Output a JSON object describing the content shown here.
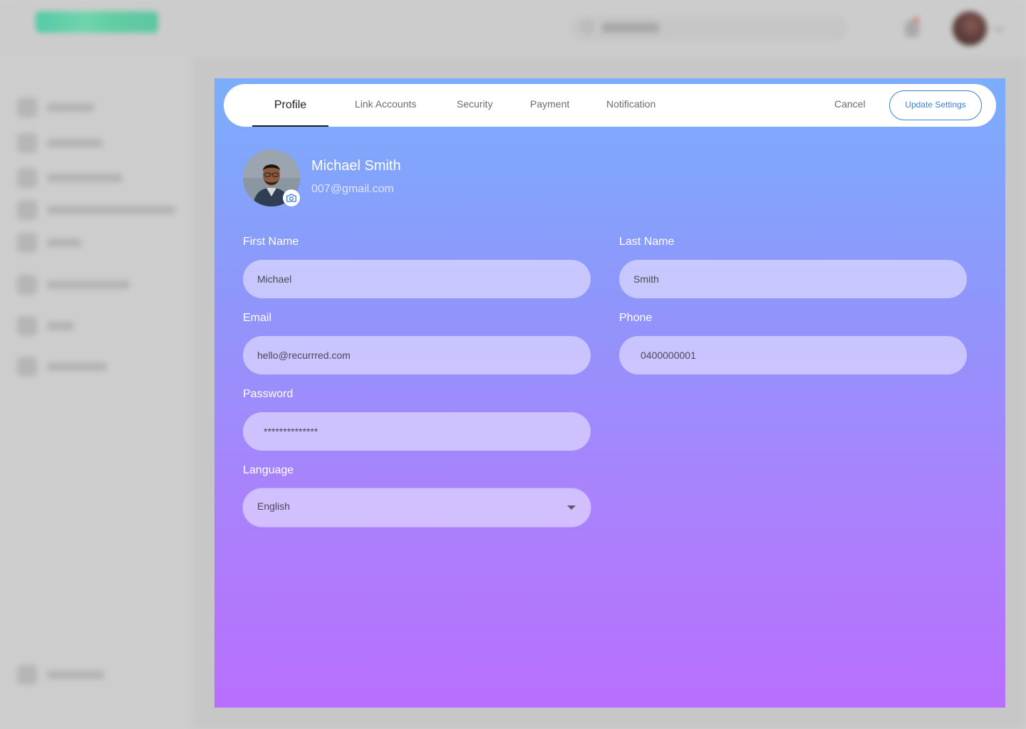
{
  "modal": {
    "tabs": [
      {
        "label": "Profile",
        "active": true
      },
      {
        "label": "Link Accounts",
        "active": false
      },
      {
        "label": "Security",
        "active": false
      },
      {
        "label": "Payment",
        "active": false
      },
      {
        "label": "Notification",
        "active": false
      }
    ],
    "cancel_label": "Cancel",
    "update_label": "Update Settings"
  },
  "profile": {
    "name": "Michael Smith",
    "email": "007@gmail.com",
    "avatar_icon": "user-photo",
    "camera_icon": "camera-icon"
  },
  "form": {
    "first_name": {
      "label": "First Name",
      "value": "Michael"
    },
    "last_name": {
      "label": "Last Name",
      "value": "Smith"
    },
    "email": {
      "label": "Email",
      "value": "hello@recurrred.com"
    },
    "phone": {
      "label": "Phone",
      "value": "0400000001"
    },
    "password": {
      "label": "Password",
      "value": "**************"
    },
    "language": {
      "label": "Language",
      "value": "English"
    }
  },
  "colors": {
    "accent": "#3c7fd6",
    "gradient_top": "#7aaefc",
    "gradient_bottom": "#b86ffd"
  }
}
